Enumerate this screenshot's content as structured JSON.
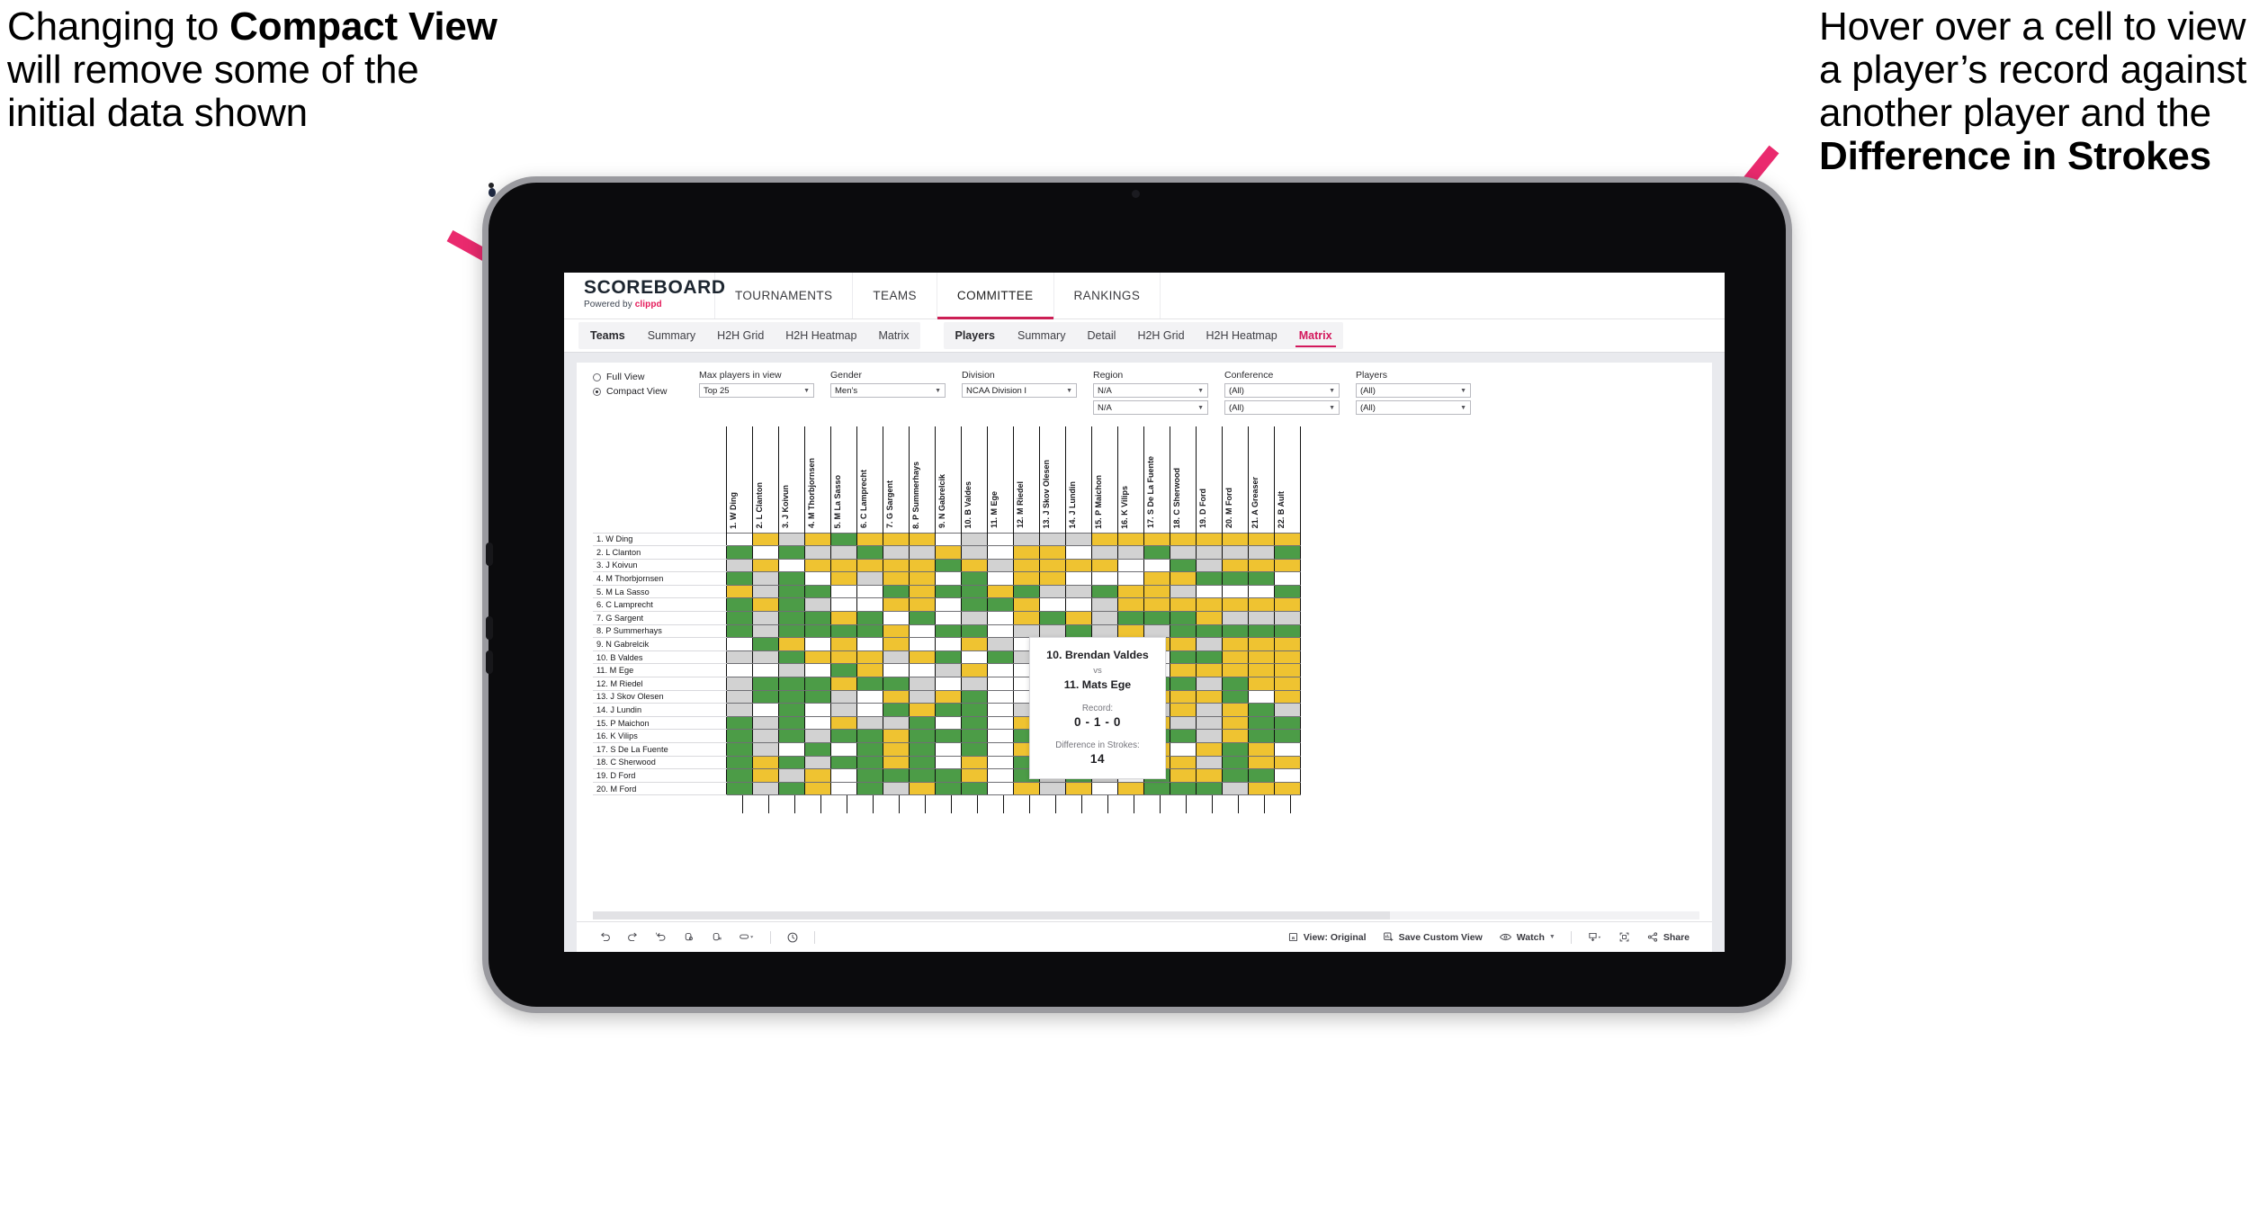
{
  "annotations": {
    "left": {
      "parts": [
        {
          "t": "Changing to ",
          "b": false
        },
        {
          "t": "Compact View",
          "b": true
        },
        {
          "t": " will remove some of the initial data shown",
          "b": false
        }
      ]
    },
    "right": {
      "parts": [
        {
          "t": "Hover over a cell to view a player’s record against another player and the ",
          "b": false
        },
        {
          "t": "Difference in Strokes",
          "b": true
        }
      ]
    },
    "arrow_color": "#ea2a6e"
  },
  "brand": {
    "wordmark": "SCOREBOARD",
    "powered_prefix": "Powered by ",
    "powered_name": "clippd"
  },
  "topnav": {
    "items": [
      {
        "label": "TOURNAMENTS",
        "active": false
      },
      {
        "label": "TEAMS",
        "active": false
      },
      {
        "label": "COMMITTEE",
        "active": true
      },
      {
        "label": "RANKINGS",
        "active": false
      }
    ]
  },
  "subnav": {
    "groups": [
      {
        "label": "Teams",
        "tabs": [
          {
            "label": "Summary",
            "active": false
          },
          {
            "label": "H2H Grid",
            "active": false
          },
          {
            "label": "H2H Heatmap",
            "active": false
          },
          {
            "label": "Matrix",
            "active": false
          }
        ]
      },
      {
        "label": "Players",
        "tabs": [
          {
            "label": "Summary",
            "active": false
          },
          {
            "label": "Detail",
            "active": false
          },
          {
            "label": "H2H Grid",
            "active": false
          },
          {
            "label": "H2H Heatmap",
            "active": false
          },
          {
            "label": "Matrix",
            "active": true
          }
        ]
      }
    ],
    "active_color": "#d3185c"
  },
  "filters": {
    "view_mode": {
      "options": [
        {
          "label": "Full View",
          "selected": false
        },
        {
          "label": "Compact View",
          "selected": true
        }
      ]
    },
    "dropdowns": [
      {
        "label": "Max players in view",
        "values": [
          "Top 25"
        ]
      },
      {
        "label": "Gender",
        "values": [
          "Men’s"
        ]
      },
      {
        "label": "Division",
        "values": [
          "NCAA Division I"
        ]
      },
      {
        "label": "Region",
        "values": [
          "N/A",
          "N/A"
        ]
      },
      {
        "label": "Conference",
        "values": [
          "(All)",
          "(All)"
        ]
      },
      {
        "label": "Players",
        "values": [
          "(All)",
          "(All)"
        ]
      }
    ]
  },
  "matrix": {
    "column_headers": [
      "1. W Ding",
      "2. L Clanton",
      "3. J Koivun",
      "4. M Thorbjornsen",
      "5. M La Sasso",
      "6. C Lamprecht",
      "7. G Sargent",
      "8. P Summerhays",
      "9. N Gabrelcik",
      "10. B Valdes",
      "11. M Ege",
      "12. M Riedel",
      "13. J Skov Olesen",
      "14. J Lundin",
      "15. P Maichon",
      "16. K Vilips",
      "17. S De La Fuente",
      "18. C Sherwood",
      "19. D Ford",
      "20. M Ford",
      "21. A Greaser",
      "22. B Ault"
    ],
    "row_headers": [
      "1. W Ding",
      "2. L Clanton",
      "3. J Koivun",
      "4. M Thorbjornsen",
      "5. M La Sasso",
      "6. C Lamprecht",
      "7. G Sargent",
      "8. P Summerhays",
      "9. N Gabrelcik",
      "10. B Valdes",
      "11. M Ege",
      "12. M Riedel",
      "13. J Skov Olesen",
      "14. J Lundin",
      "15. P Maichon",
      "16. K Vilips",
      "17. S De La Fuente",
      "18. C Sherwood",
      "19. D Ford",
      "20. M Ford"
    ],
    "legend": {
      "win": "#4c9c47",
      "tie": "#efc331",
      "loss": "#d2d2d2",
      "none": "#ffffff"
    },
    "cells": [
      [
        "w",
        "y",
        "a",
        "y",
        "g",
        "y",
        "y",
        "y",
        "w",
        "a",
        "w",
        "a",
        "a",
        "a",
        "y",
        "y",
        "y",
        "y",
        "y",
        "y",
        "y",
        "y"
      ],
      [
        "g",
        "w",
        "g",
        "a",
        "a",
        "g",
        "a",
        "a",
        "y",
        "a",
        "w",
        "y",
        "y",
        "w",
        "a",
        "a",
        "g",
        "a",
        "a",
        "a",
        "a",
        "g"
      ],
      [
        "a",
        "y",
        "w",
        "y",
        "y",
        "y",
        "y",
        "y",
        "g",
        "y",
        "a",
        "y",
        "y",
        "y",
        "y",
        "w",
        "w",
        "g",
        "a",
        "y",
        "y",
        "y"
      ],
      [
        "g",
        "a",
        "g",
        "w",
        "y",
        "a",
        "y",
        "y",
        "w",
        "g",
        "w",
        "y",
        "y",
        "w",
        "w",
        "w",
        "y",
        "y",
        "g",
        "g",
        "g",
        "w"
      ],
      [
        "y",
        "a",
        "g",
        "g",
        "w",
        "w",
        "g",
        "y",
        "g",
        "g",
        "y",
        "g",
        "a",
        "a",
        "g",
        "y",
        "y",
        "a",
        "w",
        "w",
        "w",
        "g"
      ],
      [
        "g",
        "y",
        "g",
        "a",
        "w",
        "w",
        "y",
        "y",
        "w",
        "g",
        "g",
        "y",
        "w",
        "w",
        "a",
        "y",
        "y",
        "y",
        "y",
        "y",
        "y",
        "y"
      ],
      [
        "g",
        "a",
        "g",
        "g",
        "y",
        "g",
        "w",
        "g",
        "w",
        "a",
        "w",
        "y",
        "g",
        "y",
        "a",
        "g",
        "g",
        "g",
        "y",
        "a",
        "a",
        "a"
      ],
      [
        "g",
        "a",
        "g",
        "g",
        "g",
        "g",
        "y",
        "w",
        "g",
        "g",
        "w",
        "a",
        "a",
        "g",
        "a",
        "y",
        "a",
        "g",
        "g",
        "g",
        "g",
        "g"
      ],
      [
        "w",
        "g",
        "y",
        "w",
        "y",
        "w",
        "y",
        "w",
        "w",
        "y",
        "a",
        "w",
        "g",
        "y",
        "w",
        "w",
        "y",
        "y",
        "a",
        "y",
        "y",
        "y"
      ],
      [
        "a",
        "a",
        "g",
        "y",
        "y",
        "y",
        "a",
        "y",
        "g",
        "w",
        "g",
        "a",
        "y",
        "y",
        "w",
        "y",
        "w",
        "g",
        "g",
        "y",
        "y",
        "y"
      ],
      [
        "w",
        "w",
        "a",
        "w",
        "g",
        "y",
        "w",
        "w",
        "a",
        "y",
        "w",
        "w",
        "w",
        "g",
        "w",
        "w",
        "w",
        "y",
        "y",
        "y",
        "y",
        "y"
      ],
      [
        "a",
        "g",
        "g",
        "g",
        "y",
        "g",
        "g",
        "a",
        "w",
        "a",
        "w",
        "w",
        "a",
        "g",
        "a",
        "a",
        "g",
        "g",
        "a",
        "g",
        "y",
        "y"
      ],
      [
        "a",
        "g",
        "g",
        "g",
        "a",
        "w",
        "y",
        "a",
        "y",
        "g",
        "w",
        "w",
        "w",
        "a",
        "y",
        "a",
        "y",
        "y",
        "y",
        "g",
        "w",
        "y"
      ],
      [
        "a",
        "w",
        "g",
        "w",
        "a",
        "w",
        "g",
        "y",
        "g",
        "g",
        "w",
        "a",
        "y",
        "w",
        "a",
        "g",
        "a",
        "y",
        "a",
        "y",
        "g",
        "a"
      ],
      [
        "g",
        "a",
        "g",
        "w",
        "y",
        "a",
        "a",
        "g",
        "w",
        "g",
        "w",
        "y",
        "g",
        "a",
        "w",
        "g",
        "y",
        "a",
        "a",
        "y",
        "g",
        "g"
      ],
      [
        "g",
        "a",
        "g",
        "a",
        "g",
        "g",
        "y",
        "g",
        "g",
        "g",
        "w",
        "g",
        "w",
        "g",
        "a",
        "w",
        "g",
        "g",
        "a",
        "y",
        "g",
        "g"
      ],
      [
        "g",
        "a",
        "w",
        "g",
        "w",
        "g",
        "y",
        "g",
        "w",
        "g",
        "w",
        "y",
        "w",
        "g",
        "y",
        "y",
        "y",
        "w",
        "y",
        "g",
        "y",
        "w"
      ],
      [
        "g",
        "y",
        "g",
        "a",
        "g",
        "g",
        "y",
        "g",
        "w",
        "y",
        "w",
        "g",
        "w",
        "g",
        "y",
        "g",
        "y",
        "y",
        "a",
        "g",
        "y",
        "y"
      ],
      [
        "g",
        "y",
        "a",
        "y",
        "w",
        "g",
        "g",
        "g",
        "g",
        "y",
        "w",
        "g",
        "a",
        "g",
        "a",
        "w",
        "g",
        "y",
        "y",
        "g",
        "g",
        "w"
      ],
      [
        "g",
        "a",
        "g",
        "y",
        "w",
        "g",
        "a",
        "y",
        "g",
        "g",
        "w",
        "y",
        "a",
        "y",
        "w",
        "y",
        "g",
        "g",
        "g",
        "a",
        "y",
        "y"
      ]
    ]
  },
  "tooltip": {
    "player_a": "10. Brendan Valdes",
    "vs": "vs",
    "player_b": "11. Mats Ege",
    "record_label": "Record:",
    "record_value": "0 - 1 - 0",
    "diff_label": "Difference in Strokes:",
    "diff_value": "14"
  },
  "bottombar": {
    "items": [
      {
        "name": "undo",
        "label": ""
      },
      {
        "name": "redo",
        "label": ""
      },
      {
        "name": "revert",
        "label": ""
      },
      {
        "name": "refresh",
        "label": ""
      },
      {
        "name": "pause",
        "label": ""
      },
      {
        "name": "highlight",
        "label": ""
      },
      {
        "name": "sep",
        "label": ""
      },
      {
        "name": "clock",
        "label": ""
      },
      {
        "name": "sep",
        "label": ""
      },
      {
        "name": "view-original",
        "label": "View: Original"
      },
      {
        "name": "save-custom-view",
        "label": "Save Custom View"
      },
      {
        "name": "watch",
        "label": "Watch"
      },
      {
        "name": "sep",
        "label": ""
      },
      {
        "name": "download",
        "label": ""
      },
      {
        "name": "fullscreen",
        "label": ""
      },
      {
        "name": "share",
        "label": "Share"
      }
    ]
  }
}
